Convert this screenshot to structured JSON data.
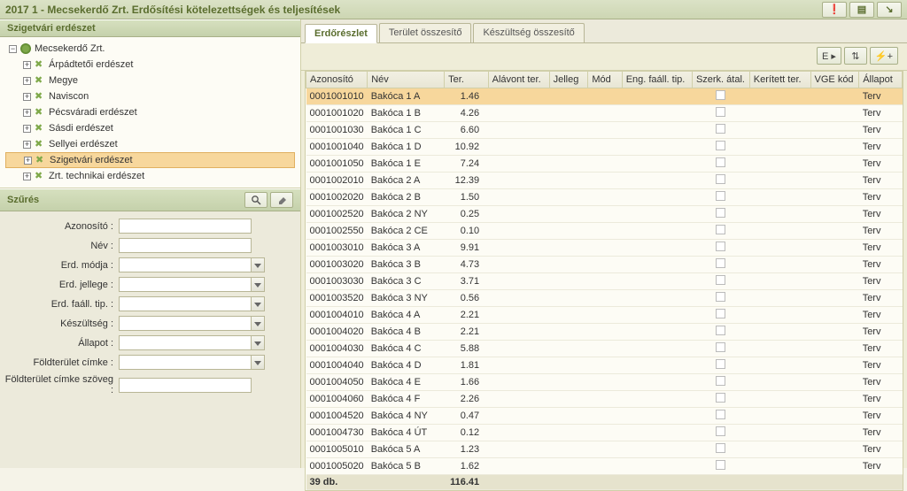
{
  "title": "2017 1 - Mecsekerdő Zrt. Erdősítési kötelezettségek és teljesítések",
  "tree": {
    "header": "Szigetvári erdészet",
    "root": "Mecsekerdő Zrt.",
    "children": [
      "Árpádtetői erdészet",
      "Megye",
      "Naviscon",
      "Pécsváradi erdészet",
      "Sásdi erdészet",
      "Sellyei erdészet",
      "Szigetvári erdészet",
      "Zrt. technikai erdészet"
    ],
    "selected_index": 6
  },
  "filter": {
    "header": "Szűrés",
    "labels": {
      "azonosito": "Azonosító :",
      "nev": "Név :",
      "erd_modja": "Erd. módja :",
      "erd_jellege": "Erd. jellege :",
      "erd_faall_tip": "Erd. faáll. tip. :",
      "keszultseg": "Készültség :",
      "allapot": "Állapot :",
      "foldterulet_cimke": "Földterület címke :",
      "foldterulet_cimke_szoveg": "Földterület címke szöveg :"
    }
  },
  "tabs": [
    "Erdőrészlet",
    "Terület összesítő",
    "Készültség összesítő"
  ],
  "toolbar": {
    "b1": "E ▸",
    "b2": "⇅",
    "b3": "⚡+"
  },
  "columns": [
    "Azonosító",
    "Név",
    "Ter.",
    "Alávont ter.",
    "Jelleg",
    "Mód",
    "Eng. faáll. tip.",
    "Szerk. átal.",
    "Kerített ter.",
    "VGE kód",
    "Állapot"
  ],
  "rows": [
    {
      "az": "0001001010",
      "nev": "Bakóca 1 A",
      "ter": "1.46",
      "all": "Terv"
    },
    {
      "az": "0001001020",
      "nev": "Bakóca 1 B",
      "ter": "4.26",
      "all": "Terv"
    },
    {
      "az": "0001001030",
      "nev": "Bakóca 1 C",
      "ter": "6.60",
      "all": "Terv"
    },
    {
      "az": "0001001040",
      "nev": "Bakóca 1 D",
      "ter": "10.92",
      "all": "Terv"
    },
    {
      "az": "0001001050",
      "nev": "Bakóca 1 E",
      "ter": "7.24",
      "all": "Terv"
    },
    {
      "az": "0001002010",
      "nev": "Bakóca 2 A",
      "ter": "12.39",
      "all": "Terv"
    },
    {
      "az": "0001002020",
      "nev": "Bakóca 2 B",
      "ter": "1.50",
      "all": "Terv"
    },
    {
      "az": "0001002520",
      "nev": "Bakóca 2 NY",
      "ter": "0.25",
      "all": "Terv"
    },
    {
      "az": "0001002550",
      "nev": "Bakóca 2 CE",
      "ter": "0.10",
      "all": "Terv"
    },
    {
      "az": "0001003010",
      "nev": "Bakóca 3 A",
      "ter": "9.91",
      "all": "Terv"
    },
    {
      "az": "0001003020",
      "nev": "Bakóca 3 B",
      "ter": "4.73",
      "all": "Terv"
    },
    {
      "az": "0001003030",
      "nev": "Bakóca 3 C",
      "ter": "3.71",
      "all": "Terv"
    },
    {
      "az": "0001003520",
      "nev": "Bakóca 3 NY",
      "ter": "0.56",
      "all": "Terv"
    },
    {
      "az": "0001004010",
      "nev": "Bakóca 4 A",
      "ter": "2.21",
      "all": "Terv"
    },
    {
      "az": "0001004020",
      "nev": "Bakóca 4 B",
      "ter": "2.21",
      "all": "Terv"
    },
    {
      "az": "0001004030",
      "nev": "Bakóca 4 C",
      "ter": "5.88",
      "all": "Terv"
    },
    {
      "az": "0001004040",
      "nev": "Bakóca 4 D",
      "ter": "1.81",
      "all": "Terv"
    },
    {
      "az": "0001004050",
      "nev": "Bakóca 4 E",
      "ter": "1.66",
      "all": "Terv"
    },
    {
      "az": "0001004060",
      "nev": "Bakóca 4 F",
      "ter": "2.26",
      "all": "Terv"
    },
    {
      "az": "0001004520",
      "nev": "Bakóca 4 NY",
      "ter": "0.47",
      "all": "Terv"
    },
    {
      "az": "0001004730",
      "nev": "Bakóca 4 ÚT",
      "ter": "0.12",
      "all": "Terv"
    },
    {
      "az": "0001005010",
      "nev": "Bakóca 5 A",
      "ter": "1.23",
      "all": "Terv"
    },
    {
      "az": "0001005020",
      "nev": "Bakóca 5 B",
      "ter": "1.62",
      "all": "Terv"
    }
  ],
  "footer": {
    "count": "39 db.",
    "sum_ter": "116.41"
  }
}
